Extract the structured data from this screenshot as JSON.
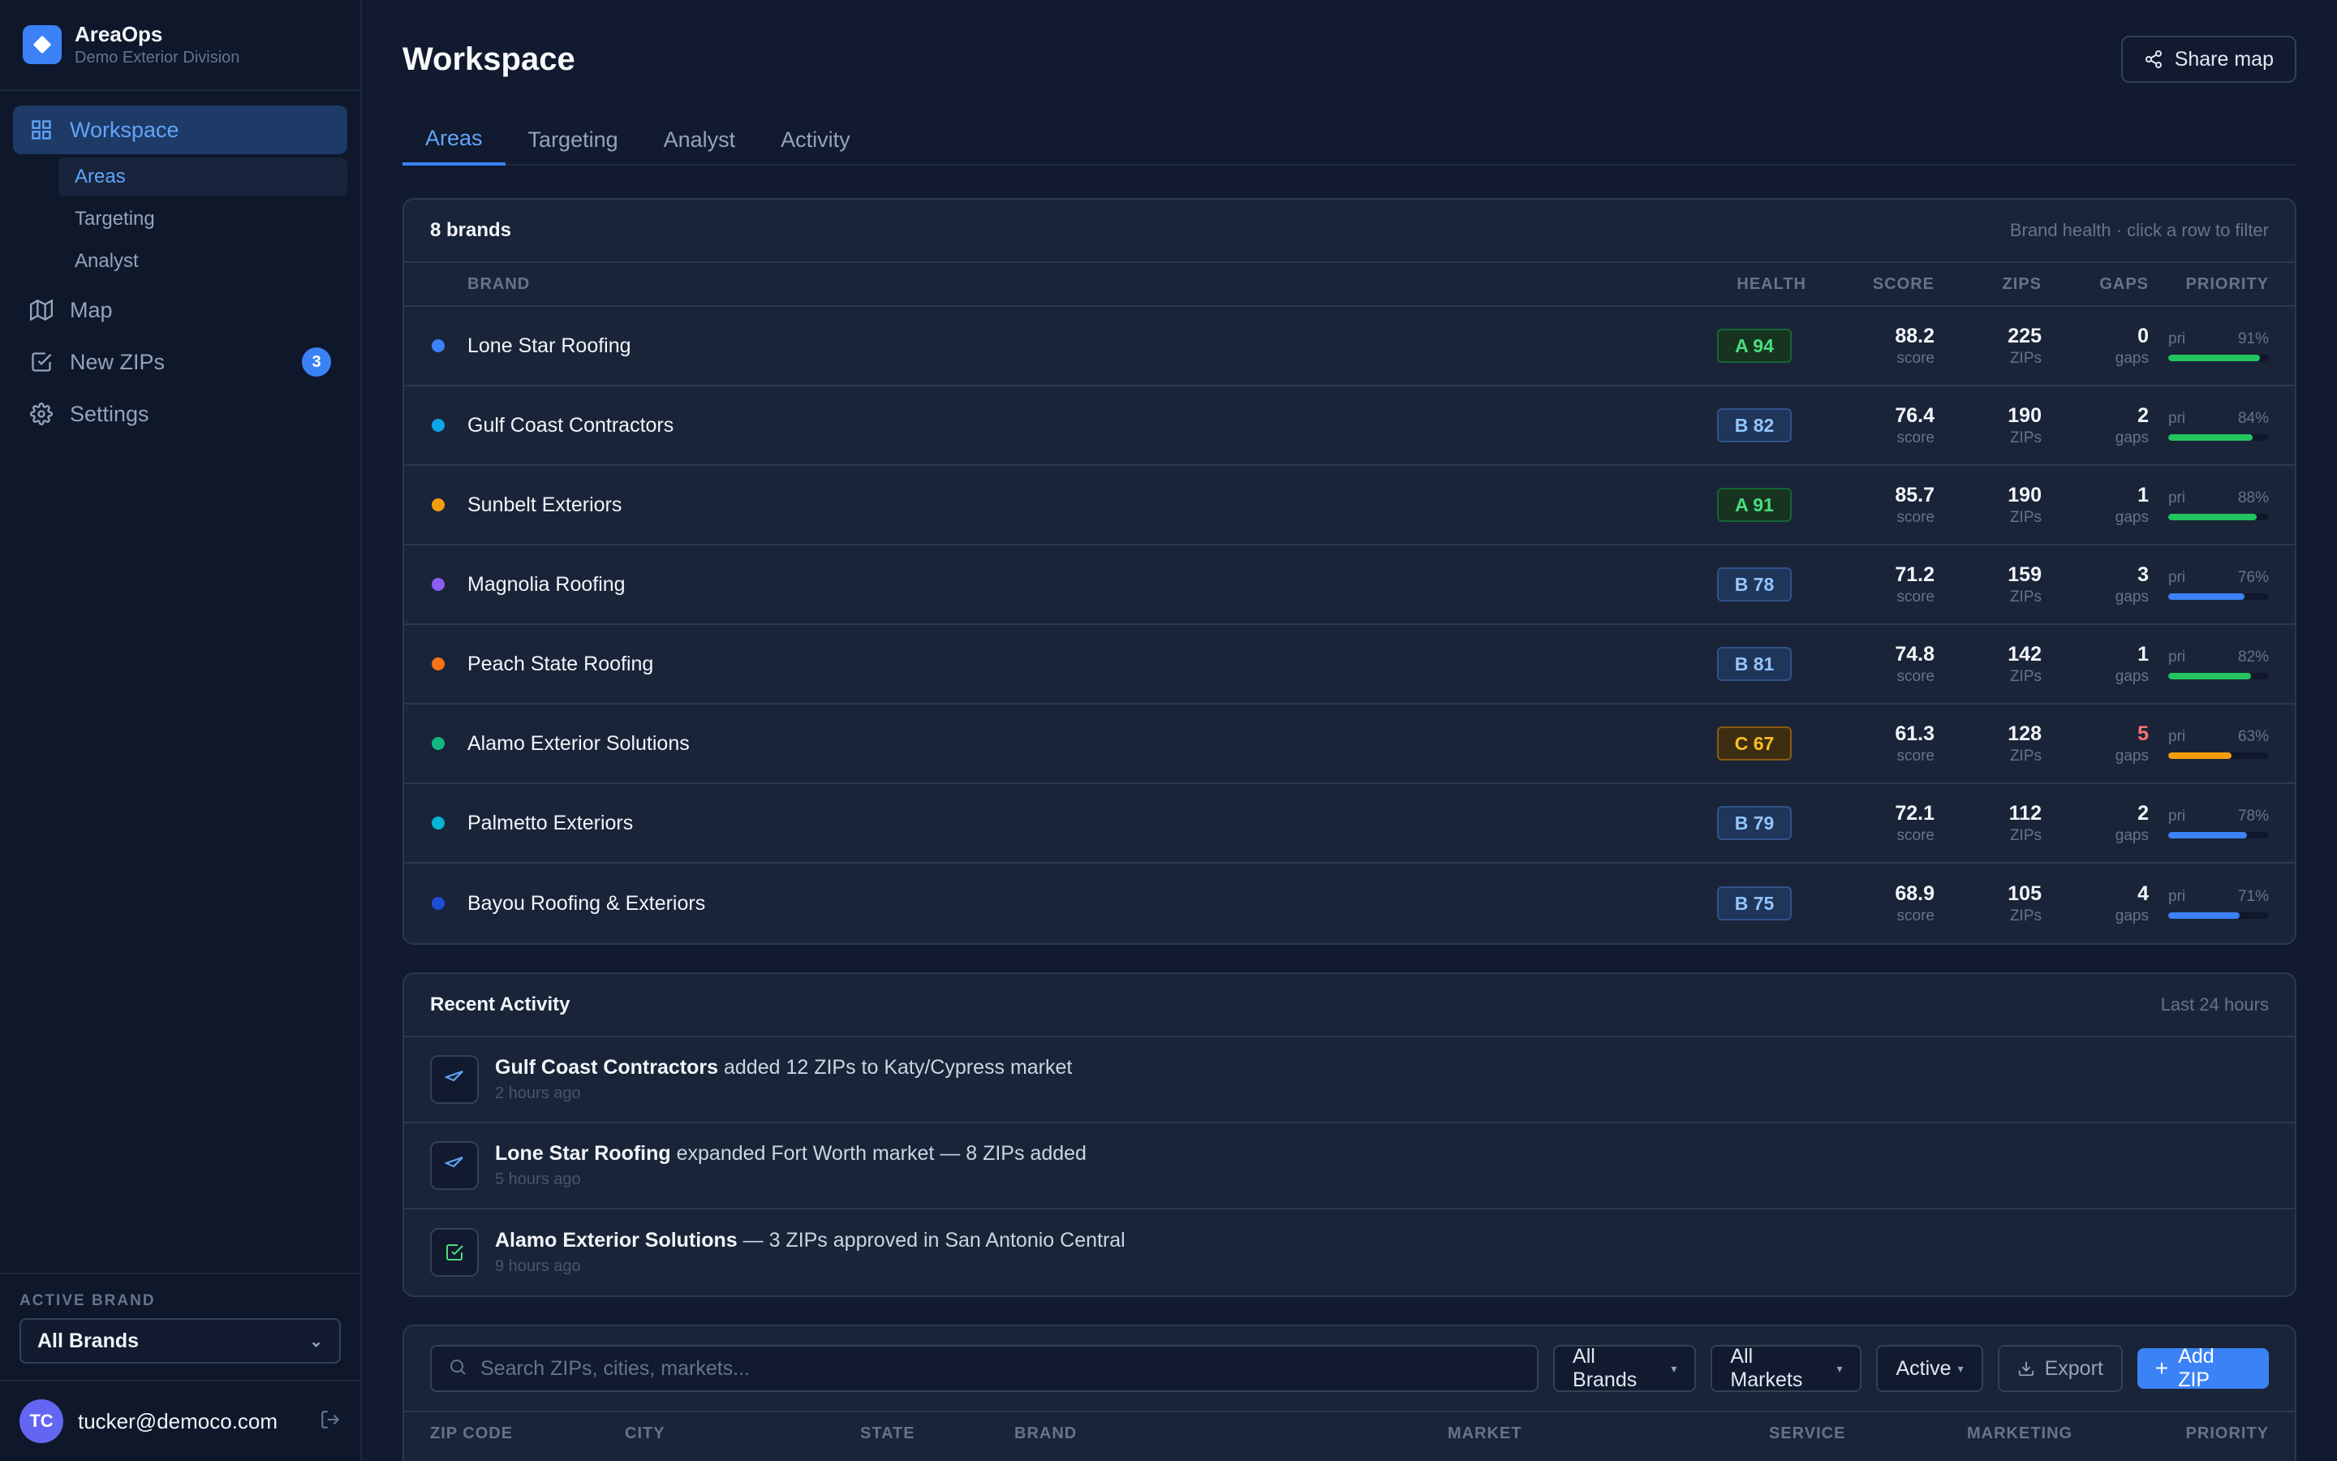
{
  "app": {
    "name": "AreaOps",
    "subtitle": "Demo Exterior Division"
  },
  "nav": {
    "items": [
      {
        "label": "Workspace",
        "icon": "grid-icon",
        "active": true
      },
      {
        "label": "Map",
        "icon": "map-icon"
      },
      {
        "label": "New ZIPs",
        "icon": "check-square-icon",
        "badge": "3"
      },
      {
        "label": "Settings",
        "icon": "gear-icon"
      }
    ],
    "sub_items": [
      {
        "label": "Areas",
        "active": true
      },
      {
        "label": "Targeting"
      },
      {
        "label": "Analyst"
      }
    ]
  },
  "active_brand": {
    "label": "ACTIVE BRAND",
    "value": "All Brands"
  },
  "user": {
    "initials": "TC",
    "email": "tucker@democo.com"
  },
  "header": {
    "title": "Workspace",
    "share_label": "Share map"
  },
  "tabs": [
    "Areas",
    "Targeting",
    "Analyst",
    "Activity"
  ],
  "brands_card": {
    "title": "8 brands",
    "note": "Brand health · click a row to filter",
    "columns": {
      "brand": "BRAND",
      "health": "HEALTH",
      "score": "SCORE",
      "zips": "ZIPS",
      "gaps": "GAPS",
      "priority": "PRIORITY"
    },
    "rows": [
      {
        "name": "Lone Star Roofing",
        "color": "#3b82f6",
        "grade": "A",
        "health": "A 94",
        "score": "88.2",
        "zips": "225",
        "gaps": "0",
        "gaps_alert": false,
        "priority": "91%",
        "pri_fraction": 0.91,
        "bar_color": "#22c55e"
      },
      {
        "name": "Gulf Coast Contractors",
        "color": "#0ea5e9",
        "grade": "B",
        "health": "B 82",
        "score": "76.4",
        "zips": "190",
        "gaps": "2",
        "gaps_alert": false,
        "priority": "84%",
        "pri_fraction": 0.84,
        "bar_color": "#22c55e"
      },
      {
        "name": "Sunbelt Exteriors",
        "color": "#f59e0b",
        "grade": "A",
        "health": "A 91",
        "score": "85.7",
        "zips": "190",
        "gaps": "1",
        "gaps_alert": false,
        "priority": "88%",
        "pri_fraction": 0.88,
        "bar_color": "#22c55e"
      },
      {
        "name": "Magnolia Roofing",
        "color": "#8b5cf6",
        "grade": "B",
        "health": "B 78",
        "score": "71.2",
        "zips": "159",
        "gaps": "3",
        "gaps_alert": false,
        "priority": "76%",
        "pri_fraction": 0.76,
        "bar_color": "#3b82f6"
      },
      {
        "name": "Peach State Roofing",
        "color": "#f97316",
        "grade": "B",
        "health": "B 81",
        "score": "74.8",
        "zips": "142",
        "gaps": "1",
        "gaps_alert": false,
        "priority": "82%",
        "pri_fraction": 0.82,
        "bar_color": "#22c55e"
      },
      {
        "name": "Alamo Exterior Solutions",
        "color": "#10b981",
        "grade": "C",
        "health": "C 67",
        "score": "61.3",
        "zips": "128",
        "gaps": "5",
        "gaps_alert": true,
        "priority": "63%",
        "pri_fraction": 0.63,
        "bar_color": "#f59e0b"
      },
      {
        "name": "Palmetto Exteriors",
        "color": "#06b6d4",
        "grade": "B",
        "health": "B 79",
        "score": "72.1",
        "zips": "112",
        "gaps": "2",
        "gaps_alert": false,
        "priority": "78%",
        "pri_fraction": 0.78,
        "bar_color": "#3b82f6"
      },
      {
        "name": "Bayou Roofing & Exteriors",
        "color": "#1d4ed8",
        "grade": "B",
        "health": "B 75",
        "score": "68.9",
        "zips": "105",
        "gaps": "4",
        "gaps_alert": false,
        "priority": "71%",
        "pri_fraction": 0.71,
        "bar_color": "#3b82f6"
      }
    ],
    "sub_labels": {
      "score": "score",
      "zips": "ZIPs",
      "gaps": "gaps",
      "pri": "pri"
    }
  },
  "activity": {
    "title": "Recent Activity",
    "note": "Last 24 hours",
    "items": [
      {
        "icon": "send-icon",
        "brand": "Gulf Coast Contractors",
        "text": "added 12 ZIPs to Katy/Cypress market",
        "time": "2 hours ago"
      },
      {
        "icon": "send-icon",
        "brand": "Lone Star Roofing",
        "text": "expanded Fort Worth market — 8 ZIPs added",
        "time": "5 hours ago"
      },
      {
        "icon": "check-square-icon",
        "brand": "Alamo Exterior Solutions",
        "text": "— 3 ZIPs approved in San Antonio Central",
        "time": "9 hours ago"
      }
    ]
  },
  "zip_toolbar": {
    "search_placeholder": "Search ZIPs, cities, markets...",
    "filters": [
      "All Brands",
      "All Markets",
      "Active"
    ],
    "export_label": "Export",
    "add_label": "Add ZIP",
    "columns": [
      "ZIP CODE",
      "CITY",
      "STATE",
      "BRAND",
      "MARKET",
      "SERVICE",
      "MARKETING",
      "PRIORITY"
    ]
  },
  "colors": {
    "accent": "#3b82f6",
    "alert": "#f87171"
  }
}
